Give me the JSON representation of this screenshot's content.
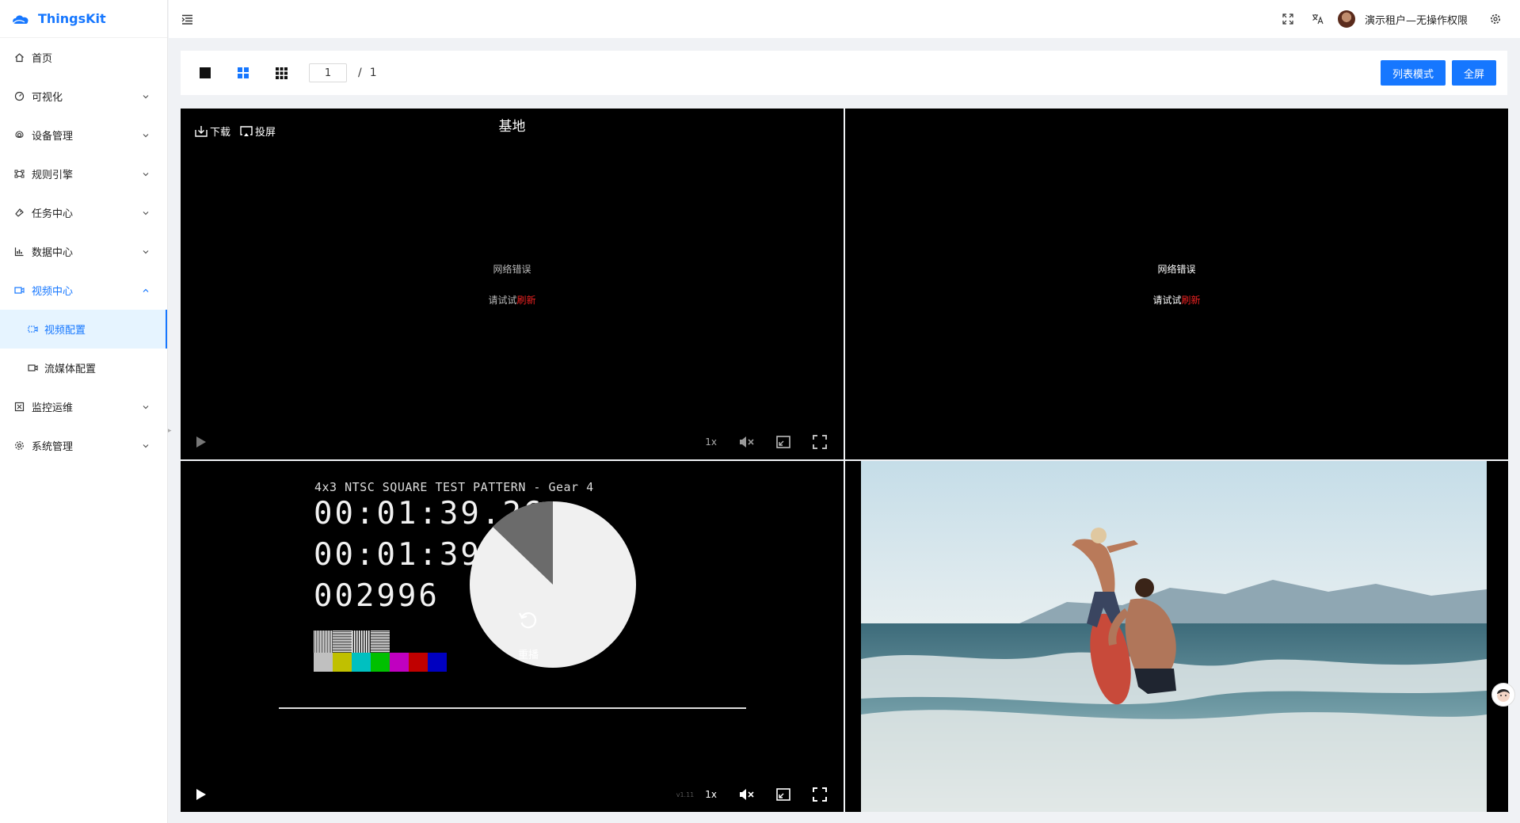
{
  "app": {
    "name": "ThingsKit"
  },
  "sidebar": {
    "items": [
      {
        "label": "首页",
        "icon": "home-icon",
        "has_children": false
      },
      {
        "label": "可视化",
        "icon": "dashboard-icon",
        "has_children": true
      },
      {
        "label": "设备管理",
        "icon": "device-icon",
        "has_children": true
      },
      {
        "label": "规则引擎",
        "icon": "rule-engine-icon",
        "has_children": true
      },
      {
        "label": "任务中心",
        "icon": "task-icon",
        "has_children": true
      },
      {
        "label": "数据中心",
        "icon": "chart-icon",
        "has_children": true
      },
      {
        "label": "视频中心",
        "icon": "video-icon",
        "has_children": true,
        "open": true,
        "children": [
          {
            "label": "视频配置",
            "icon": "video-config-icon",
            "active": true
          },
          {
            "label": "流媒体配置",
            "icon": "stream-icon",
            "active": false
          }
        ]
      },
      {
        "label": "监控运维",
        "icon": "monitor-icon",
        "has_children": true
      },
      {
        "label": "系统管理",
        "icon": "settings-icon",
        "has_children": true
      }
    ]
  },
  "header": {
    "user_name": "演示租户—无操作权限"
  },
  "toolbar": {
    "page_current": "1",
    "page_sep": "/",
    "page_total": "1",
    "list_mode_label": "列表模式",
    "fullscreen_label": "全屏"
  },
  "players": {
    "p1": {
      "title": "基地",
      "download_label": "下载",
      "cast_label": "投屏",
      "error_text": "网络错误",
      "retry_text": "请试试",
      "refresh_text": "刷新",
      "speed": "1x"
    },
    "p2": {
      "error_text": "网络错误",
      "retry_text": "请试试",
      "refresh_text": "刷新"
    },
    "p3": {
      "caption": "4x3 NTSC SQUARE TEST PATTERN - Gear 4",
      "timecode_1": "00:01:39.26",
      "timecode_2": "00:01:39;28",
      "frame_count": "002996",
      "replay_label": "重播",
      "version": "v1.11",
      "speed": "1x"
    }
  },
  "colors": {
    "primary": "#1677ff",
    "error_link": "#e22222",
    "active_bg": "#e6f4ff"
  }
}
